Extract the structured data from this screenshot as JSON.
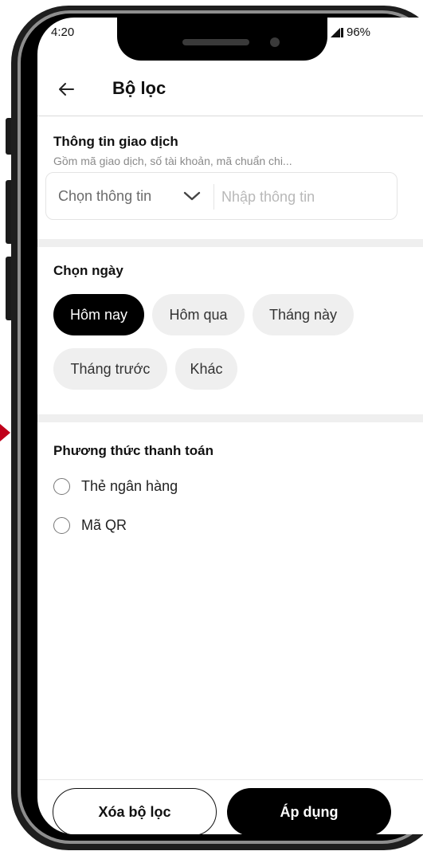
{
  "status_bar": {
    "time": "4:20",
    "battery": "96%"
  },
  "header": {
    "back_icon": "arrow-left-icon",
    "title": "Bộ lọc"
  },
  "transaction_info": {
    "title": "Thông tin giao dịch",
    "subtitle": "Gồm mã giao dịch, số tài khoản, mã chuẩn chi...",
    "select_label": "Chọn thông tin",
    "select_icon": "chevron-down-icon",
    "input_value": "",
    "input_placeholder": "Nhập thông tin"
  },
  "date_filter": {
    "title": "Chọn ngày",
    "chips": [
      {
        "label": "Hôm nay",
        "selected": true
      },
      {
        "label": "Hôm qua",
        "selected": false
      },
      {
        "label": "Tháng này",
        "selected": false
      },
      {
        "label": "Tháng trước",
        "selected": false
      },
      {
        "label": "Khác",
        "selected": false
      }
    ]
  },
  "payment_method": {
    "title": "Phương thức thanh toán",
    "options": [
      {
        "label": "Thẻ ngân hàng",
        "checked": false
      },
      {
        "label": "Mã QR",
        "checked": false
      }
    ]
  },
  "footer": {
    "clear_label": "Xóa bộ lọc",
    "apply_label": "Áp dụng"
  },
  "colors": {
    "accent": "#000000",
    "chip_bg": "#efefef",
    "pointer_arrow": "#c0001a"
  }
}
